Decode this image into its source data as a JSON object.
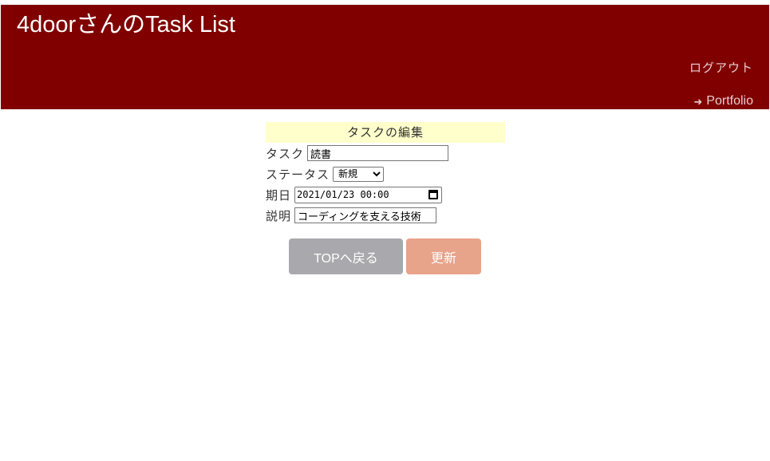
{
  "header": {
    "title": "4doorさんのTask List",
    "logout_label": "ログアウト",
    "portfolio_label": "Portfolio",
    "portfolio_icon": "sign-out-icon",
    "background_color": "#800000"
  },
  "form": {
    "title": "タスクの編集",
    "task": {
      "label": "タスク",
      "value": "読書"
    },
    "status": {
      "label": "ステータス",
      "selected": "新規"
    },
    "due": {
      "label": "期日",
      "value": "2021/01/23 00:00"
    },
    "description": {
      "label": "説明",
      "value": "コーディングを支える技術"
    }
  },
  "buttons": {
    "back_label": "TOPへ戻る",
    "update_label": "更新",
    "back_color": "#a9a9ad",
    "update_color": "#e8a38b"
  }
}
